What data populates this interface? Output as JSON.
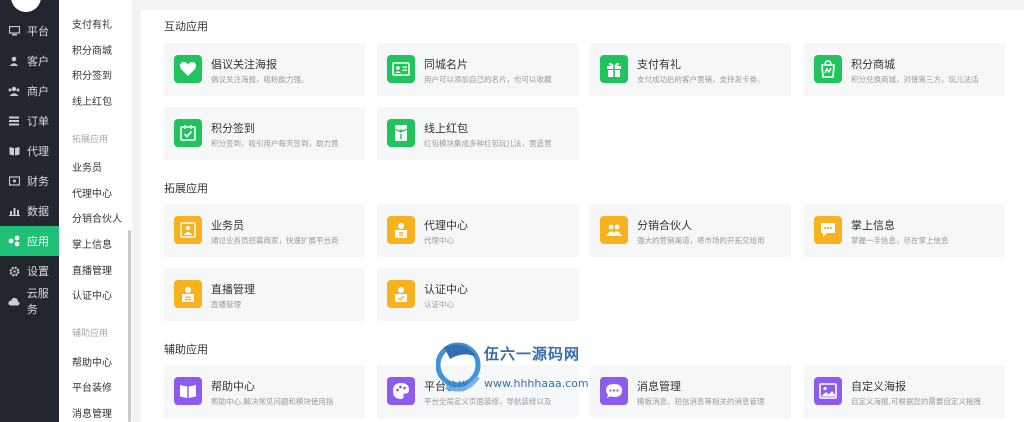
{
  "nav": {
    "items": [
      {
        "label": "平台",
        "icon": "monitor-icon"
      },
      {
        "label": "客户",
        "icon": "user-icon"
      },
      {
        "label": "商户",
        "icon": "users-icon"
      },
      {
        "label": "订单",
        "icon": "list-icon"
      },
      {
        "label": "代理",
        "icon": "book-icon"
      },
      {
        "label": "财务",
        "icon": "wallet-icon"
      },
      {
        "label": "数据",
        "icon": "bar-chart-icon"
      },
      {
        "label": "应用",
        "icon": "apps-icon"
      },
      {
        "label": "设置",
        "icon": "gear-icon"
      },
      {
        "label": "云服务",
        "icon": "cloud-icon"
      }
    ],
    "active_index": 7
  },
  "subnav": {
    "items": [
      "支付有礼",
      "积分商城",
      "积分签到",
      "线上红包"
    ],
    "group2": "拓展应用",
    "items2": [
      "业务员",
      "代理中心",
      "分销合伙人",
      "掌上信息",
      "直播管理",
      "认证中心"
    ],
    "group3": "辅助应用",
    "items3": [
      "帮助中心",
      "平台装修",
      "消息管理"
    ]
  },
  "sections": {
    "interactive": {
      "title": "互动应用",
      "cards": [
        {
          "name": "倡议关注海报",
          "desc": "倡议关注海报，吸粉能力强。",
          "icon": "heart-icon",
          "color": "#21c45c"
        },
        {
          "name": "同城名片",
          "desc": "用户可以添加自己的名片，也可以收藏",
          "icon": "id-card-icon",
          "color": "#21c45c"
        },
        {
          "name": "支付有礼",
          "desc": "支付成功后的客户营销，支持发卡券、",
          "icon": "gift-icon",
          "color": "#21c45c"
        },
        {
          "name": "积分商城",
          "desc": "积分兑换商城，对接第三方，玩儿法活",
          "icon": "shopping-bag-icon",
          "color": "#21c45c"
        },
        {
          "name": "积分签到",
          "desc": "积分签到，吸引用户每天签到，助力营",
          "icon": "calendar-check-icon",
          "color": "#21c45c"
        },
        {
          "name": "线上红包",
          "desc": "红包模块集成多种红包玩儿法，营造营",
          "icon": "red-packet-icon",
          "color": "#21c45c"
        }
      ]
    },
    "extension": {
      "title": "拓展应用",
      "cards": [
        {
          "name": "业务员",
          "desc": "通过业务员招募商家，快速扩展平台商",
          "icon": "people-icon",
          "color": "#f7b21d"
        },
        {
          "name": "代理中心",
          "desc": "代理中心",
          "icon": "agent-icon",
          "color": "#f7b21d"
        },
        {
          "name": "分销合伙人",
          "desc": "强大的营销渠道，将市场的开拓交给用",
          "icon": "partners-icon",
          "color": "#f7b21d"
        },
        {
          "name": "掌上信息",
          "desc": "掌握一手信息，尽在掌上信息",
          "icon": "message-icon",
          "color": "#f7b21d"
        },
        {
          "name": "直播管理",
          "desc": "直播管理",
          "icon": "live-icon",
          "color": "#f7b21d"
        },
        {
          "name": "认证中心",
          "desc": "认证中心",
          "icon": "certify-icon",
          "color": "#f7b21d"
        }
      ]
    },
    "assist": {
      "title": "辅助应用",
      "cards": [
        {
          "name": "帮助中心",
          "desc": "帮助中心,解决常见问题和模块使用指",
          "icon": "open-book-icon",
          "color": "#8c5cf0"
        },
        {
          "name": "平台装修",
          "desc": "平台全局定义页面装修，导航装修以及",
          "icon": "palette-icon",
          "color": "#8c5cf0"
        },
        {
          "name": "消息管理",
          "desc": "模板消息、短信消息等相关的消息管理",
          "icon": "chat-icon",
          "color": "#8c5cf0"
        },
        {
          "name": "自定义海报",
          "desc": "自定义海报,可根据您的需要自定义拖拽",
          "icon": "image-icon",
          "color": "#8c5cf0"
        }
      ]
    }
  },
  "watermark": {
    "line1": "伍六一源码网",
    "line2": "www.hhhhaaa.com"
  }
}
